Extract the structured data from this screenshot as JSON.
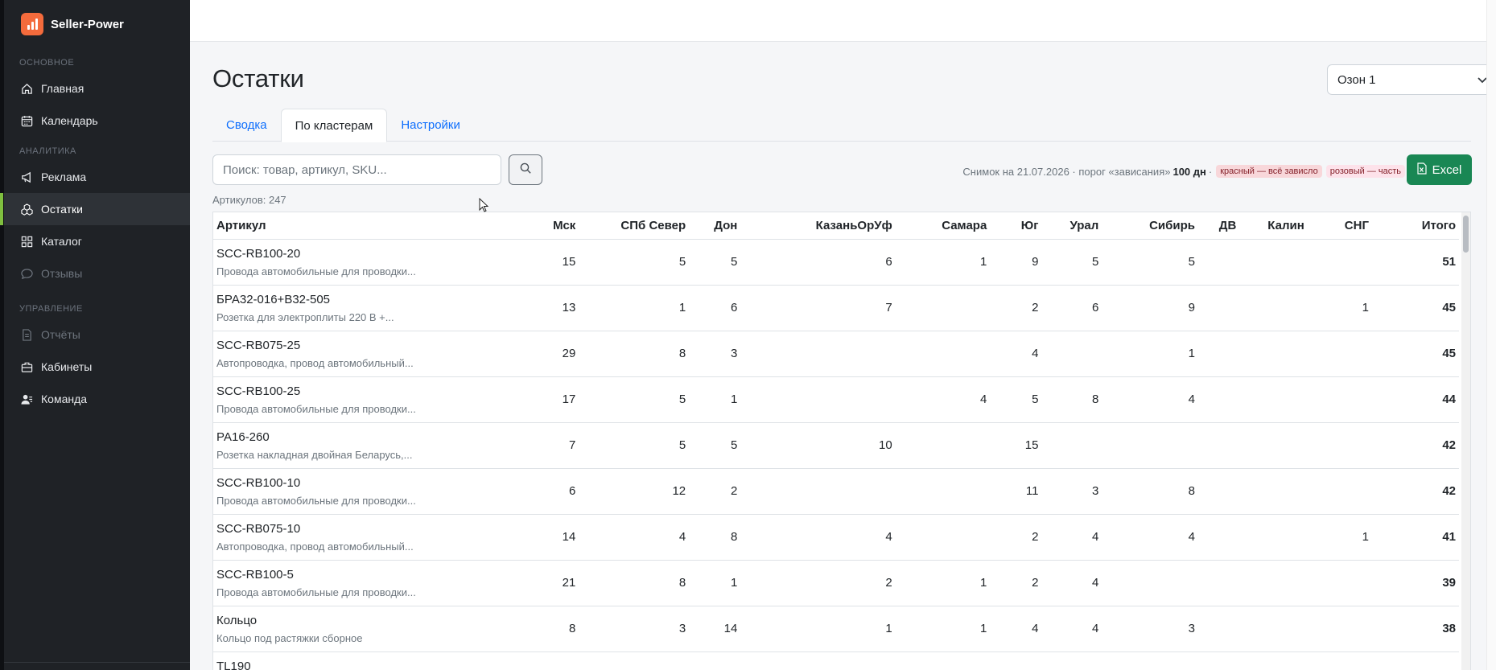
{
  "brand": {
    "name": "Seller-Power"
  },
  "sidebar": {
    "sections": [
      {
        "label": "ОСНОВНОЕ",
        "items": [
          {
            "label": "Главная",
            "icon": "home-icon",
            "state": "normal"
          },
          {
            "label": "Календарь",
            "icon": "calendar-icon",
            "state": "normal"
          }
        ]
      },
      {
        "label": "АНАЛИТИКА",
        "items": [
          {
            "label": "Реклама",
            "icon": "megaphone-icon",
            "state": "normal"
          },
          {
            "label": "Остатки",
            "icon": "boxes-icon",
            "state": "active"
          },
          {
            "label": "Каталог",
            "icon": "grid-icon",
            "state": "normal"
          },
          {
            "label": "Отзывы",
            "icon": "chat-icon",
            "state": "disabled"
          }
        ]
      },
      {
        "label": "УПРАВЛЕНИЕ",
        "items": [
          {
            "label": "Отчёты",
            "icon": "document-icon",
            "state": "disabled"
          },
          {
            "label": "Кабинеты",
            "icon": "briefcase-icon",
            "state": "normal"
          },
          {
            "label": "Команда",
            "icon": "users-icon",
            "state": "normal"
          }
        ]
      }
    ]
  },
  "page": {
    "title": "Остатки"
  },
  "account_select": {
    "value": "Озон 1"
  },
  "tabs": [
    {
      "label": "Сводка",
      "active": false
    },
    {
      "label": "По кластерам",
      "active": true
    },
    {
      "label": "Настройки",
      "active": false
    }
  ],
  "search": {
    "placeholder": "Поиск: товар, артикул, SKU..."
  },
  "snapshot": {
    "prefix": "Снимок на 21.07.2026 · порог «зависания»",
    "threshold": "100 дн",
    "sep": "·",
    "badge_red": "красный — всё зависло",
    "badge_pink": "розовый — часть"
  },
  "excel_label": "Excel",
  "count_label": "Артикулов: 247",
  "colors": {
    "accent": "#0d6efd",
    "excel": "#198754",
    "sidebar": "#1f2226",
    "active_marker": "#7fbf3f",
    "logo": "#f46b3c"
  },
  "table": {
    "columns": [
      "Артикул",
      "Мск",
      "СПб Север",
      "Дон",
      "КазаньОрУф",
      "Самара",
      "Юг",
      "Урал",
      "Сибирь",
      "ДВ",
      "Калин",
      "СНГ",
      "Итого"
    ],
    "rows": [
      {
        "sku": "SCC-RB100-20",
        "desc": "Провода автомобильные для проводки...",
        "values": [
          "15",
          "5",
          "5",
          "6",
          "1",
          "9",
          "5",
          "5",
          "",
          "",
          "",
          "51"
        ]
      },
      {
        "sku": "БРА32-016+В32-505",
        "desc": "Розетка для электроплиты 220 В +...",
        "values": [
          "13",
          "1",
          "6",
          "7",
          "",
          "2",
          "6",
          "9",
          "",
          "",
          "1",
          "45"
        ]
      },
      {
        "sku": "SCC-RB075-25",
        "desc": "Автопроводка, провод автомобильный...",
        "values": [
          "29",
          "8",
          "3",
          "",
          "",
          "4",
          "",
          "1",
          "",
          "",
          "",
          "45"
        ]
      },
      {
        "sku": "SCC-RB100-25",
        "desc": "Провода автомобильные для проводки...",
        "values": [
          "17",
          "5",
          "1",
          "",
          "4",
          "5",
          "8",
          "4",
          "",
          "",
          "",
          "44"
        ]
      },
      {
        "sku": "РА16-260",
        "desc": "Розетка накладная двойная Беларусь,...",
        "values": [
          "7",
          "5",
          "5",
          "10",
          "",
          "15",
          "",
          "",
          "",
          "",
          "",
          "42"
        ]
      },
      {
        "sku": "SCC-RB100-10",
        "desc": "Провода автомобильные для проводки...",
        "values": [
          "6",
          "12",
          "2",
          "",
          "",
          "11",
          "3",
          "8",
          "",
          "",
          "",
          "42"
        ]
      },
      {
        "sku": "SCC-RB075-10",
        "desc": "Автопроводка, провод автомобильный...",
        "values": [
          "14",
          "4",
          "8",
          "4",
          "",
          "2",
          "4",
          "4",
          "",
          "",
          "1",
          "41"
        ]
      },
      {
        "sku": "SCC-RB100-5",
        "desc": "Провода автомобильные для проводки...",
        "values": [
          "21",
          "8",
          "1",
          "2",
          "1",
          "2",
          "4",
          "",
          "",
          "",
          "",
          "39"
        ]
      },
      {
        "sku": "Кольцо",
        "desc": "Кольцо под растяжки сборное",
        "values": [
          "8",
          "3",
          "14",
          "1",
          "1",
          "4",
          "4",
          "3",
          "",
          "",
          "",
          "38"
        ]
      },
      {
        "sku": "TL190",
        "desc": "",
        "values": [
          "",
          "",
          "",
          "",
          "",
          "",
          "",
          "",
          "",
          "",
          "",
          ""
        ]
      }
    ]
  }
}
